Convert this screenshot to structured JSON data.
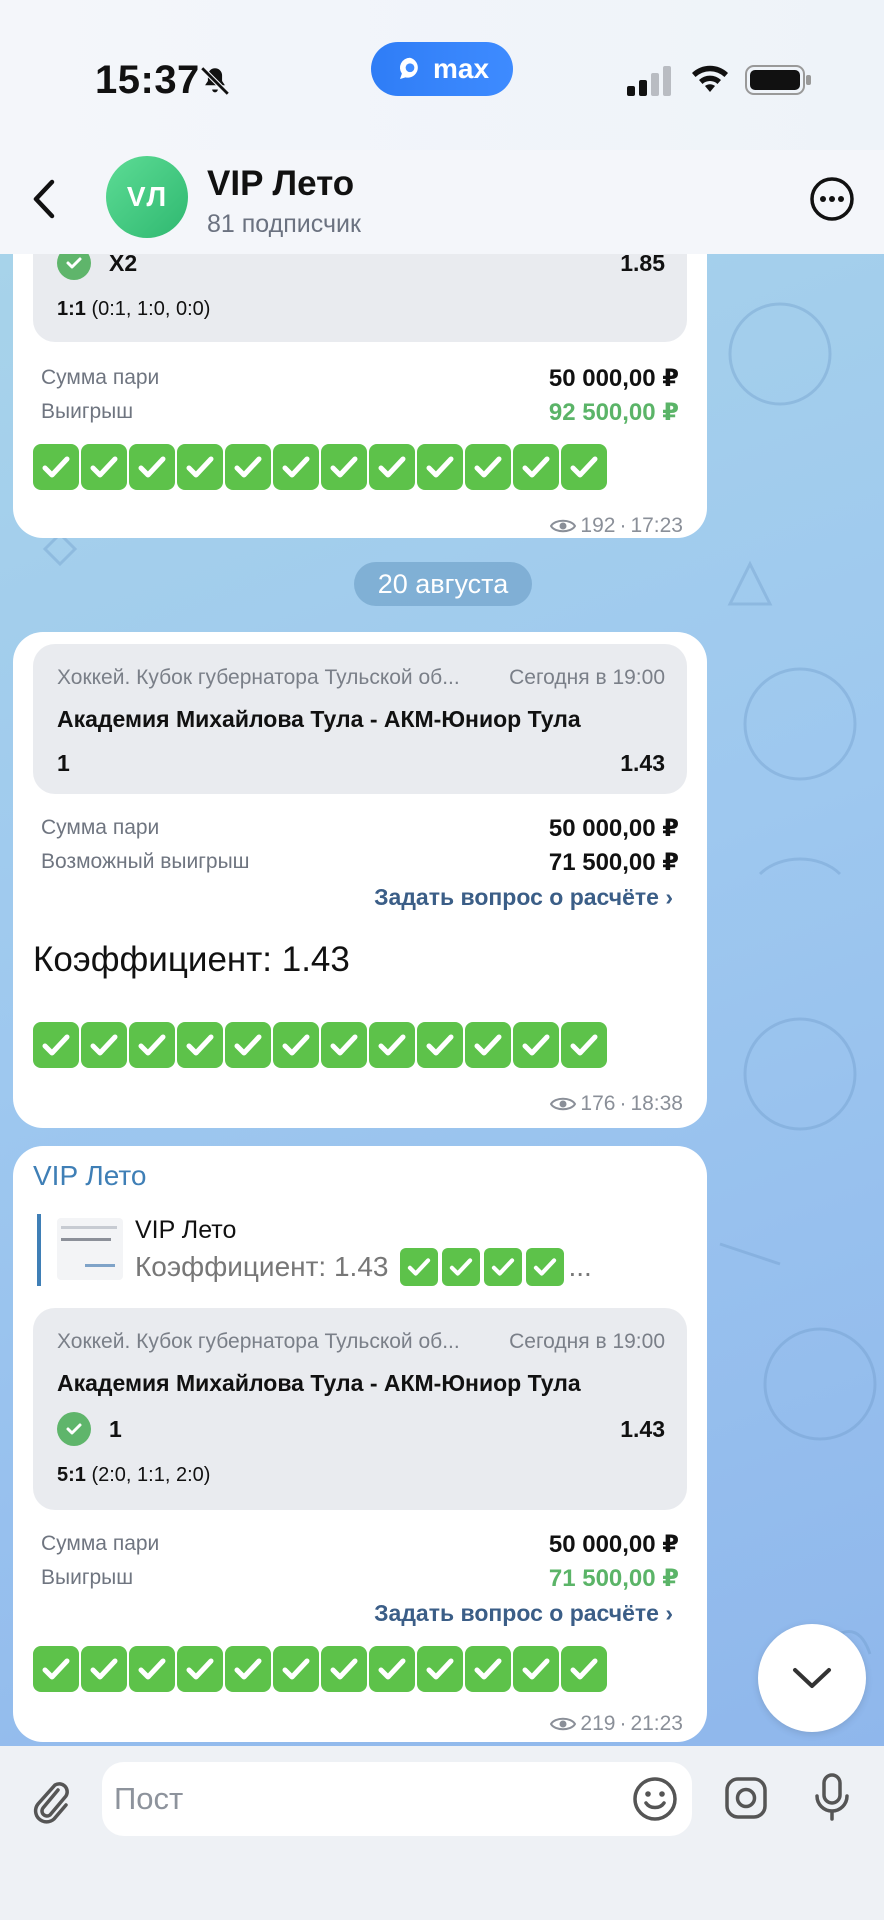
{
  "status_bar": {
    "time": "15:37",
    "app_badge": "max",
    "icons": [
      "bell-slash-icon",
      "signal-icon",
      "wifi-icon",
      "battery-icon"
    ]
  },
  "header": {
    "back": "chevron-left-icon",
    "avatar_initials": "VЛ",
    "avatar_color": "#3cc47c",
    "title": "VIP Лето",
    "subtitle": "81 подписчик",
    "more": "more-icon"
  },
  "messages": [
    {
      "bet": {
        "outcome": "X2",
        "odds": "1.85",
        "score_main": "1:1",
        "score_detail": "(0:1, 1:0, 0:0)"
      },
      "stake_label": "Сумма пари",
      "stake_value": "50 000,00 ₽",
      "win_label": "Выигрыш",
      "win_value": "92 500,00 ₽",
      "checkmarks": 12,
      "views": "192",
      "time": "17:23"
    },
    {
      "date_separator": "20 августа",
      "bet": {
        "league": "Хоккей. Кубок губернатора Тульской об...",
        "when": "Сегодня в 19:00",
        "match": "Академия Михайлова Тула - АКМ-Юниор Тула",
        "outcome": "1",
        "odds": "1.43"
      },
      "stake_label": "Сумма пари",
      "stake_value": "50 000,00 ₽",
      "win_label": "Возможный выигрыш",
      "win_value": "71 500,00 ₽",
      "ask_link": "Задать вопрос о расчёте ›",
      "text": "Коэффициент: 1.43",
      "checkmarks": 12,
      "views": "176",
      "time": "18:38"
    },
    {
      "author": "VIP Лето",
      "reply": {
        "name": "VIP Лето",
        "text": "Коэффициент: 1.43",
        "checkmarks": 4,
        "ellipsis": "..."
      },
      "bet": {
        "league": "Хоккей. Кубок губернатора Тульской об...",
        "when": "Сегодня в 19:00",
        "match": "Академия Михайлова Тула - АКМ-Юниор Тула",
        "outcome": "1",
        "odds": "1.43",
        "score_main": "5:1",
        "score_detail": "(2:0, 1:1, 2:0)"
      },
      "stake_label": "Сумма пари",
      "stake_value": "50 000,00 ₽",
      "win_label": "Выигрыш",
      "win_value": "71 500,00 ₽",
      "ask_link": "Задать вопрос о расчёте ›",
      "checkmarks": 12,
      "views": "219",
      "time": "21:23"
    }
  ],
  "input": {
    "placeholder": "Пост"
  },
  "colors": {
    "accent": "#3f7fb6",
    "win": "#5bb468",
    "check": "#5dc24a",
    "max_brand": "#2f7df6"
  }
}
